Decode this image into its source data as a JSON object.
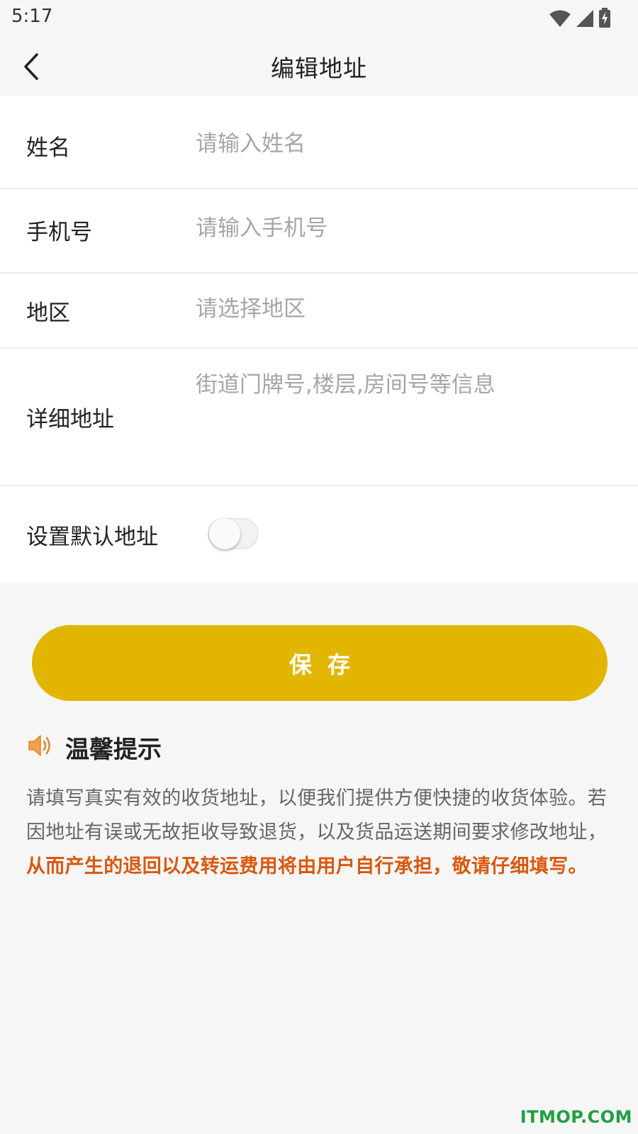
{
  "status_bar": {
    "time": "5:17",
    "icons": [
      "wifi-icon",
      "signal-icon",
      "battery-charging-icon"
    ]
  },
  "nav": {
    "title": "编辑地址",
    "back_icon": "chevron-left-icon"
  },
  "form": {
    "name": {
      "label": "姓名",
      "placeholder": "请输入姓名",
      "value": ""
    },
    "phone": {
      "label": "手机号",
      "placeholder": "请输入手机号",
      "value": ""
    },
    "region": {
      "label": "地区",
      "placeholder": "请选择地区",
      "value": ""
    },
    "address": {
      "label": "详细地址",
      "placeholder": "街道门牌号,楼层,房间号等信息",
      "value": ""
    },
    "default": {
      "label": "设置默认地址",
      "checked": false
    }
  },
  "save_button": {
    "label": "保存",
    "color": "#e2b500"
  },
  "tips": {
    "icon": "speaker-icon",
    "title": "温馨提示",
    "text": "请填写真实有效的收货地址，以便我们提供方便快捷的收货体验。若因地址有误或无故拒收导致退货，以及货品运送期间要求修改地址，",
    "warning": "从而产生的退回以及转运费用将由用户自行承担，敬请仔细填写。",
    "warning_color": "#d9580f"
  },
  "watermark": "ITMOP.COM"
}
